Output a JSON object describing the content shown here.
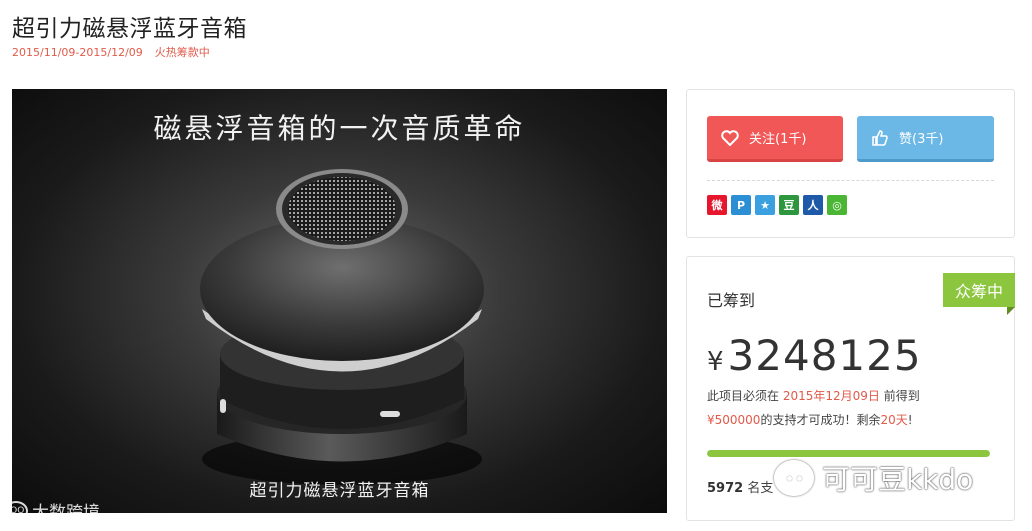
{
  "project": {
    "title": "超引力磁悬浮蓝牙音箱",
    "date_range": "2015/11/09-2015/12/09",
    "status_text": "火热筹款中"
  },
  "media": {
    "headline": "磁悬浮音箱的一次音质革命",
    "caption": "超引力磁悬浮蓝牙音箱",
    "watermark_logo": "lOO",
    "watermark": "大数跨境"
  },
  "actions": {
    "follow_label": "关注(1千)",
    "like_label": "赞(3千)",
    "share_icons": [
      {
        "name": "weibo-icon",
        "glyph": "微",
        "color": "#e6162d"
      },
      {
        "name": "qzone-icon",
        "glyph": "P",
        "color": "#2c8fd6"
      },
      {
        "name": "qq-icon",
        "glyph": "★",
        "color": "#3aa0e0"
      },
      {
        "name": "douban-icon",
        "glyph": "豆",
        "color": "#2e963d"
      },
      {
        "name": "renren-icon",
        "glyph": "人",
        "color": "#1e5aa8"
      },
      {
        "name": "wechat-icon",
        "glyph": "◎",
        "color": "#4bb534"
      }
    ]
  },
  "funding": {
    "badge": "众筹中",
    "raised_label": "已筹到",
    "currency": "¥",
    "amount": "3248125",
    "deadline_prefix": "此项目必须在",
    "deadline_date": "2015年12月09日",
    "deadline_suffix": "前得到",
    "goal_amount": "¥500000",
    "goal_suffix_1": "的支持才可成功！剩余",
    "days_left": "20天",
    "goal_suffix_2": "!",
    "progress_fraction": 1.0,
    "supporters_count": "5972",
    "supporters_label": "名支"
  },
  "overlay": {
    "wechat_watermark": "可可豆kkdo"
  },
  "colors": {
    "accent_red": "#f25757",
    "accent_blue": "#6bb7e6",
    "accent_green": "#8cc63f",
    "highlight": "#e05a4a"
  }
}
